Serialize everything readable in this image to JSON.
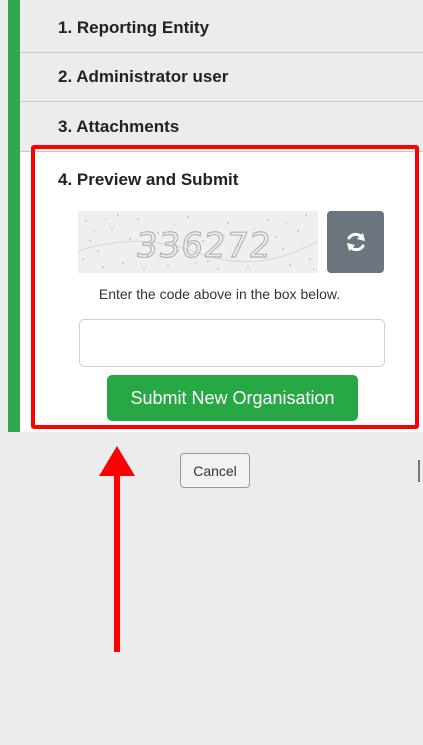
{
  "steps": [
    {
      "label": "1. Reporting Entity"
    },
    {
      "label": "2. Administrator user"
    },
    {
      "label": "3. Attachments"
    },
    {
      "label": "4. Preview and Submit"
    }
  ],
  "captcha": {
    "code": "336272",
    "refresh_icon": "refresh-icon",
    "instruction": "Enter the code above in the box below.",
    "input_value": "",
    "input_placeholder": ""
  },
  "buttons": {
    "submit_label": "Submit New Organisation",
    "cancel_label": "Cancel"
  },
  "colors": {
    "step_indicator": "#2fa84f",
    "submit_bg": "#28a745",
    "refresh_bg": "#6c757d",
    "highlight": "#ff0000"
  }
}
